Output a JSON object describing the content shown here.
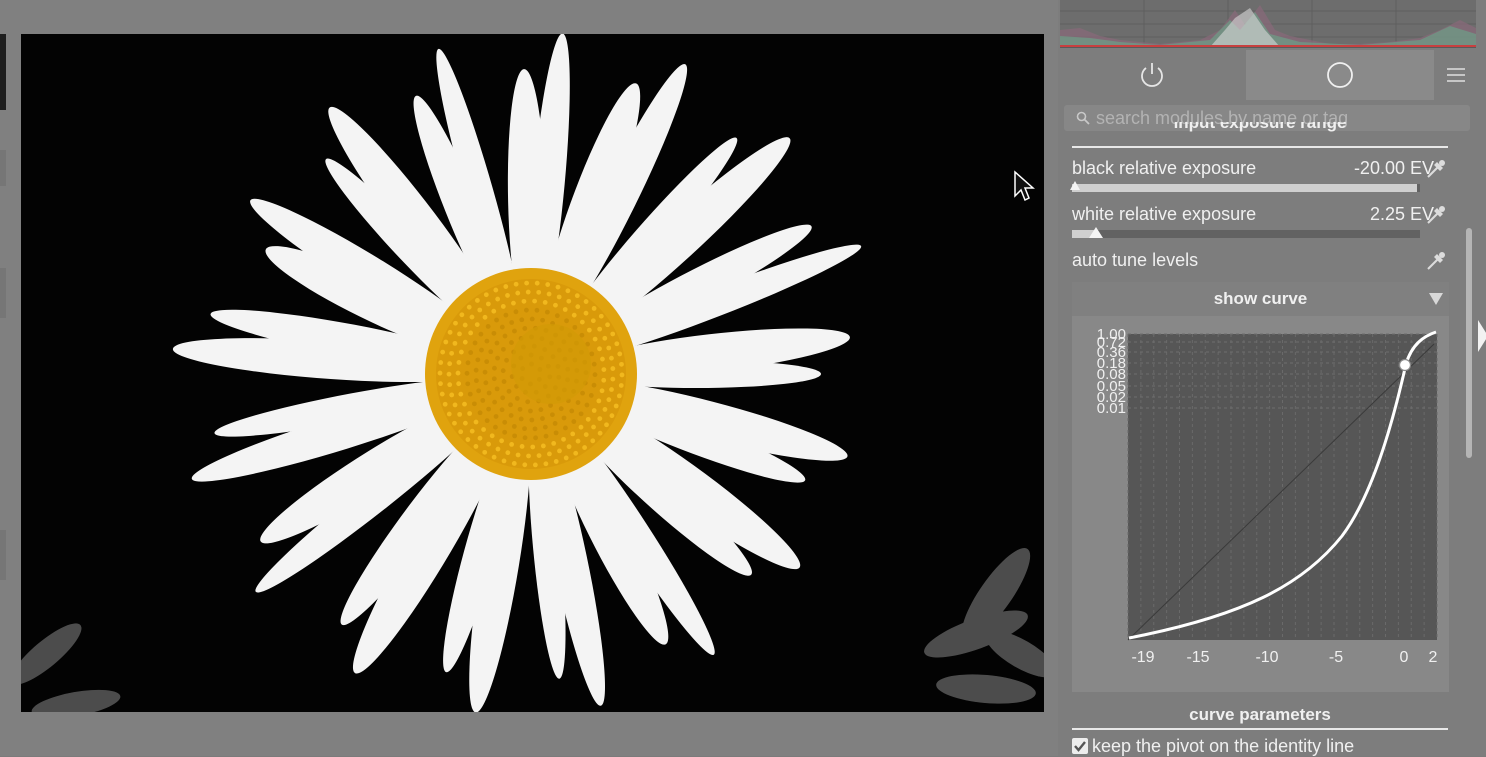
{
  "search": {
    "placeholder": "search modules by name or tag"
  },
  "tabs": {
    "active_icon": "power-icon",
    "all_icon": "circle-icon",
    "menu_icon": "hamburger-menu-icon"
  },
  "section": {
    "title": "input exposure range"
  },
  "params": {
    "black": {
      "label": "black relative exposure",
      "value": "-20.00 EV",
      "slider_fraction": 0.99
    },
    "white": {
      "label": "white relative exposure",
      "value": "2.25 EV",
      "slider_fraction": 0.07
    },
    "auto": {
      "label": "auto tune levels"
    }
  },
  "curve": {
    "title": "show curve",
    "y_ticks": [
      "1.00",
      "0.72",
      "0.36",
      "0.18",
      "0.08",
      "0.05",
      "0.02",
      "0.01"
    ],
    "x_ticks": [
      "-19",
      "-15",
      "-10",
      "-5",
      "0",
      "2"
    ]
  },
  "curve_parameters": {
    "title": "curve parameters"
  },
  "pivot": {
    "label": "keep the pivot on the identity line",
    "checked": true
  },
  "colors": {
    "panel": "#7d7d7d",
    "center_bg": "#808080",
    "image_bg": "#030303",
    "petal": "#f4f4f4",
    "disc": "#e0a30e"
  }
}
